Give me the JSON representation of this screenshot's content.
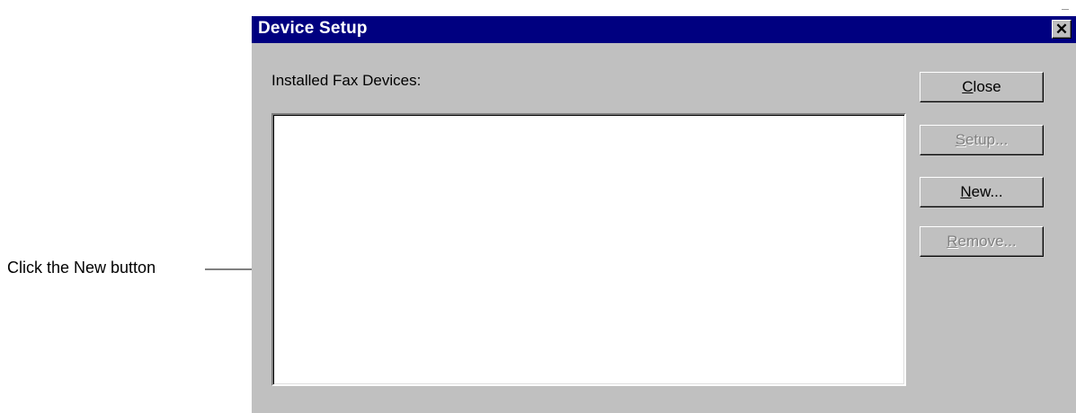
{
  "callout": {
    "text": "Click the New button"
  },
  "dialog": {
    "title": "Device Setup",
    "close_glyph": "✕",
    "list_label": "Installed Fax Devices:",
    "installed_devices": [],
    "buttons": [
      {
        "mnemonic": "C",
        "rest": "lose",
        "enabled": true
      },
      {
        "mnemonic": "S",
        "rest": "etup...",
        "enabled": false
      },
      {
        "mnemonic": "N",
        "rest": "ew...",
        "enabled": true
      },
      {
        "mnemonic": "R",
        "rest": "emove...",
        "enabled": false
      }
    ]
  },
  "colors": {
    "titlebar": "#000080",
    "dialog_face": "#c0c0c0",
    "disabled_text": "#808080"
  }
}
